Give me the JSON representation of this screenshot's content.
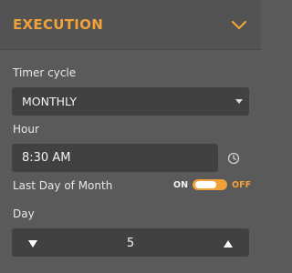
{
  "section": {
    "title": "EXECUTION",
    "collapse_icon": "chevron-down-icon",
    "accent_color": "#f0a13a"
  },
  "timer_cycle": {
    "label": "Timer cycle",
    "value": "MONTHLY",
    "caret_icon": "caret-down-icon"
  },
  "hour": {
    "label": "Hour",
    "value": "8:30 AM",
    "icon": "clock-icon"
  },
  "last_day_of_month": {
    "label": "Last Day of Month",
    "on_label": "ON",
    "off_label": "OFF",
    "state": "off"
  },
  "day": {
    "label": "Day",
    "value": "5",
    "decrement_icon": "triangle-down-icon",
    "increment_icon": "triangle-up-icon"
  }
}
